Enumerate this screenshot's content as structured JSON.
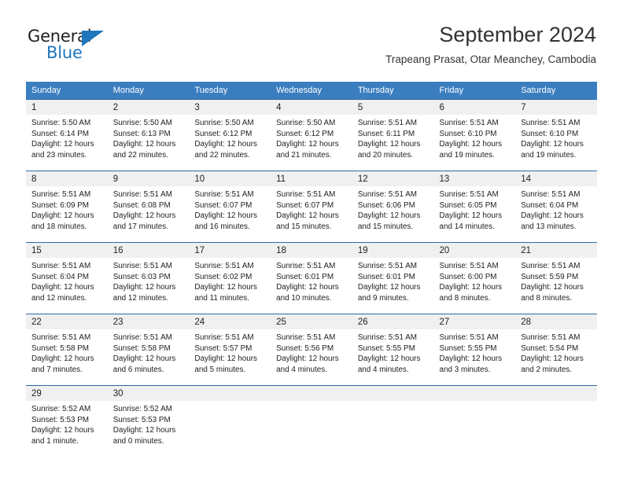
{
  "brand": {
    "name_part1": "General",
    "name_part2": "Blue"
  },
  "header": {
    "title": "September 2024",
    "subtitle": "Trapeang Prasat, Otar Meanchey, Cambodia"
  },
  "colors": {
    "header_blue": "#3b7ec0",
    "separator_blue": "#2b6ba8",
    "daynum_bg": "#f0f0f0",
    "brand_blue": "#1f76bc",
    "text": "#222222"
  },
  "weekdays": [
    "Sunday",
    "Monday",
    "Tuesday",
    "Wednesday",
    "Thursday",
    "Friday",
    "Saturday"
  ],
  "weeks": [
    [
      {
        "day": "1",
        "sunrise": "Sunrise: 5:50 AM",
        "sunset": "Sunset: 6:14 PM",
        "daylight1": "Daylight: 12 hours",
        "daylight2": "and 23 minutes."
      },
      {
        "day": "2",
        "sunrise": "Sunrise: 5:50 AM",
        "sunset": "Sunset: 6:13 PM",
        "daylight1": "Daylight: 12 hours",
        "daylight2": "and 22 minutes."
      },
      {
        "day": "3",
        "sunrise": "Sunrise: 5:50 AM",
        "sunset": "Sunset: 6:12 PM",
        "daylight1": "Daylight: 12 hours",
        "daylight2": "and 22 minutes."
      },
      {
        "day": "4",
        "sunrise": "Sunrise: 5:50 AM",
        "sunset": "Sunset: 6:12 PM",
        "daylight1": "Daylight: 12 hours",
        "daylight2": "and 21 minutes."
      },
      {
        "day": "5",
        "sunrise": "Sunrise: 5:51 AM",
        "sunset": "Sunset: 6:11 PM",
        "daylight1": "Daylight: 12 hours",
        "daylight2": "and 20 minutes."
      },
      {
        "day": "6",
        "sunrise": "Sunrise: 5:51 AM",
        "sunset": "Sunset: 6:10 PM",
        "daylight1": "Daylight: 12 hours",
        "daylight2": "and 19 minutes."
      },
      {
        "day": "7",
        "sunrise": "Sunrise: 5:51 AM",
        "sunset": "Sunset: 6:10 PM",
        "daylight1": "Daylight: 12 hours",
        "daylight2": "and 19 minutes."
      }
    ],
    [
      {
        "day": "8",
        "sunrise": "Sunrise: 5:51 AM",
        "sunset": "Sunset: 6:09 PM",
        "daylight1": "Daylight: 12 hours",
        "daylight2": "and 18 minutes."
      },
      {
        "day": "9",
        "sunrise": "Sunrise: 5:51 AM",
        "sunset": "Sunset: 6:08 PM",
        "daylight1": "Daylight: 12 hours",
        "daylight2": "and 17 minutes."
      },
      {
        "day": "10",
        "sunrise": "Sunrise: 5:51 AM",
        "sunset": "Sunset: 6:07 PM",
        "daylight1": "Daylight: 12 hours",
        "daylight2": "and 16 minutes."
      },
      {
        "day": "11",
        "sunrise": "Sunrise: 5:51 AM",
        "sunset": "Sunset: 6:07 PM",
        "daylight1": "Daylight: 12 hours",
        "daylight2": "and 15 minutes."
      },
      {
        "day": "12",
        "sunrise": "Sunrise: 5:51 AM",
        "sunset": "Sunset: 6:06 PM",
        "daylight1": "Daylight: 12 hours",
        "daylight2": "and 15 minutes."
      },
      {
        "day": "13",
        "sunrise": "Sunrise: 5:51 AM",
        "sunset": "Sunset: 6:05 PM",
        "daylight1": "Daylight: 12 hours",
        "daylight2": "and 14 minutes."
      },
      {
        "day": "14",
        "sunrise": "Sunrise: 5:51 AM",
        "sunset": "Sunset: 6:04 PM",
        "daylight1": "Daylight: 12 hours",
        "daylight2": "and 13 minutes."
      }
    ],
    [
      {
        "day": "15",
        "sunrise": "Sunrise: 5:51 AM",
        "sunset": "Sunset: 6:04 PM",
        "daylight1": "Daylight: 12 hours",
        "daylight2": "and 12 minutes."
      },
      {
        "day": "16",
        "sunrise": "Sunrise: 5:51 AM",
        "sunset": "Sunset: 6:03 PM",
        "daylight1": "Daylight: 12 hours",
        "daylight2": "and 12 minutes."
      },
      {
        "day": "17",
        "sunrise": "Sunrise: 5:51 AM",
        "sunset": "Sunset: 6:02 PM",
        "daylight1": "Daylight: 12 hours",
        "daylight2": "and 11 minutes."
      },
      {
        "day": "18",
        "sunrise": "Sunrise: 5:51 AM",
        "sunset": "Sunset: 6:01 PM",
        "daylight1": "Daylight: 12 hours",
        "daylight2": "and 10 minutes."
      },
      {
        "day": "19",
        "sunrise": "Sunrise: 5:51 AM",
        "sunset": "Sunset: 6:01 PM",
        "daylight1": "Daylight: 12 hours",
        "daylight2": "and 9 minutes."
      },
      {
        "day": "20",
        "sunrise": "Sunrise: 5:51 AM",
        "sunset": "Sunset: 6:00 PM",
        "daylight1": "Daylight: 12 hours",
        "daylight2": "and 8 minutes."
      },
      {
        "day": "21",
        "sunrise": "Sunrise: 5:51 AM",
        "sunset": "Sunset: 5:59 PM",
        "daylight1": "Daylight: 12 hours",
        "daylight2": "and 8 minutes."
      }
    ],
    [
      {
        "day": "22",
        "sunrise": "Sunrise: 5:51 AM",
        "sunset": "Sunset: 5:58 PM",
        "daylight1": "Daylight: 12 hours",
        "daylight2": "and 7 minutes."
      },
      {
        "day": "23",
        "sunrise": "Sunrise: 5:51 AM",
        "sunset": "Sunset: 5:58 PM",
        "daylight1": "Daylight: 12 hours",
        "daylight2": "and 6 minutes."
      },
      {
        "day": "24",
        "sunrise": "Sunrise: 5:51 AM",
        "sunset": "Sunset: 5:57 PM",
        "daylight1": "Daylight: 12 hours",
        "daylight2": "and 5 minutes."
      },
      {
        "day": "25",
        "sunrise": "Sunrise: 5:51 AM",
        "sunset": "Sunset: 5:56 PM",
        "daylight1": "Daylight: 12 hours",
        "daylight2": "and 4 minutes."
      },
      {
        "day": "26",
        "sunrise": "Sunrise: 5:51 AM",
        "sunset": "Sunset: 5:55 PM",
        "daylight1": "Daylight: 12 hours",
        "daylight2": "and 4 minutes."
      },
      {
        "day": "27",
        "sunrise": "Sunrise: 5:51 AM",
        "sunset": "Sunset: 5:55 PM",
        "daylight1": "Daylight: 12 hours",
        "daylight2": "and 3 minutes."
      },
      {
        "day": "28",
        "sunrise": "Sunrise: 5:51 AM",
        "sunset": "Sunset: 5:54 PM",
        "daylight1": "Daylight: 12 hours",
        "daylight2": "and 2 minutes."
      }
    ],
    [
      {
        "day": "29",
        "sunrise": "Sunrise: 5:52 AM",
        "sunset": "Sunset: 5:53 PM",
        "daylight1": "Daylight: 12 hours",
        "daylight2": "and 1 minute."
      },
      {
        "day": "30",
        "sunrise": "Sunrise: 5:52 AM",
        "sunset": "Sunset: 5:53 PM",
        "daylight1": "Daylight: 12 hours",
        "daylight2": "and 0 minutes."
      },
      {
        "day": "",
        "sunrise": "",
        "sunset": "",
        "daylight1": "",
        "daylight2": ""
      },
      {
        "day": "",
        "sunrise": "",
        "sunset": "",
        "daylight1": "",
        "daylight2": ""
      },
      {
        "day": "",
        "sunrise": "",
        "sunset": "",
        "daylight1": "",
        "daylight2": ""
      },
      {
        "day": "",
        "sunrise": "",
        "sunset": "",
        "daylight1": "",
        "daylight2": ""
      },
      {
        "day": "",
        "sunrise": "",
        "sunset": "",
        "daylight1": "",
        "daylight2": ""
      }
    ]
  ]
}
